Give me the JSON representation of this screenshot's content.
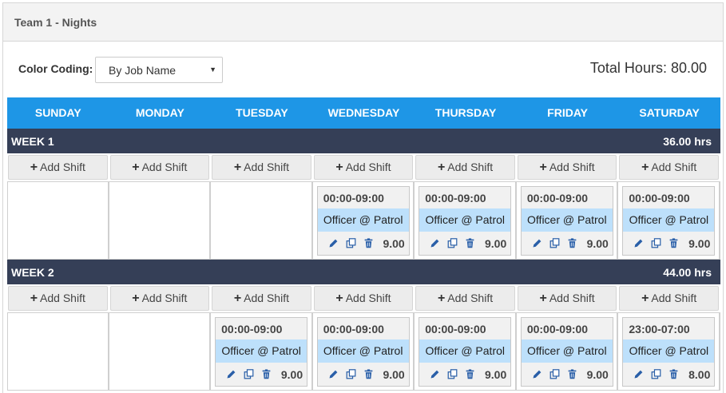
{
  "panel": {
    "title": "Team 1 - Nights"
  },
  "toolbar": {
    "color_coding_label": "Color Coding:",
    "color_coding_value": "By Job Name",
    "total_hours": "Total Hours: 80.00"
  },
  "days": [
    "SUNDAY",
    "MONDAY",
    "TUESDAY",
    "WEDNESDAY",
    "THURSDAY",
    "FRIDAY",
    "SATURDAY"
  ],
  "add_shift_label": "Add Shift",
  "weeks": [
    {
      "label": "WEEK 1",
      "hours": "36.00 hrs",
      "shifts": [
        null,
        null,
        null,
        {
          "time": "00:00-09:00",
          "job": "Officer @ Patrol",
          "hours": "9.00"
        },
        {
          "time": "00:00-09:00",
          "job": "Officer @ Patrol",
          "hours": "9.00"
        },
        {
          "time": "00:00-09:00",
          "job": "Officer @ Patrol",
          "hours": "9.00"
        },
        {
          "time": "00:00-09:00",
          "job": "Officer @ Patrol",
          "hours": "9.00"
        }
      ]
    },
    {
      "label": "WEEK 2",
      "hours": "44.00 hrs",
      "shifts": [
        null,
        null,
        {
          "time": "00:00-09:00",
          "job": "Officer @ Patrol",
          "hours": "9.00"
        },
        {
          "time": "00:00-09:00",
          "job": "Officer @ Patrol",
          "hours": "9.00"
        },
        {
          "time": "00:00-09:00",
          "job": "Officer @ Patrol",
          "hours": "9.00"
        },
        {
          "time": "00:00-09:00",
          "job": "Officer @ Patrol",
          "hours": "9.00"
        },
        {
          "time": "23:00-07:00",
          "job": "Officer @ Patrol",
          "hours": "8.00"
        }
      ]
    }
  ],
  "icons": {
    "edit": "pencil-icon",
    "copy": "copy-icon",
    "delete": "trash-icon",
    "add": "plus-icon",
    "dropdown": "caret-down-icon"
  },
  "colors": {
    "header_blue": "#1e96e6",
    "week_bar": "#353f57",
    "job_highlight": "#bde0fb",
    "icon_blue": "#2a5fa8"
  }
}
